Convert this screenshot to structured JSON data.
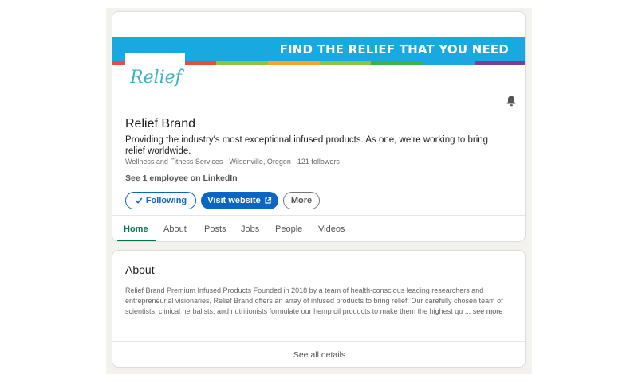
{
  "banner": {
    "text": "FIND THE RELIEF THAT YOU NEED",
    "bg_color": "#1aa8e0",
    "stripe_colors": [
      "#e94b3c",
      "#8cc63f",
      "#f4a62a",
      "#8cc63f",
      "#3bb34a",
      "#1aa8e0",
      "#7b3f99"
    ]
  },
  "logo": {
    "text": "Relief",
    "tm": "™",
    "color": "#3bb3c3"
  },
  "company": {
    "name": "Relief Brand",
    "tagline": "Providing the industry's most exceptional infused products. As one, we're working to bring relief worldwide.",
    "meta": "Wellness and Fitness Services · Wilsonville, Oregon · 121 followers",
    "employees_link": "See 1 employee on LinkedIn",
    "notification_icon": "bell-icon"
  },
  "actions": {
    "following_label": "Following",
    "following_icon": "check-icon",
    "visit_label": "Visit website",
    "visit_icon": "external-link-icon",
    "more_label": "More"
  },
  "tabs": [
    {
      "label": "Home",
      "active": true
    },
    {
      "label": "About",
      "active": false
    },
    {
      "label": "Posts",
      "active": false
    },
    {
      "label": "Jobs",
      "active": false
    },
    {
      "label": "People",
      "active": false
    },
    {
      "label": "Videos",
      "active": false
    }
  ],
  "about": {
    "title": "About",
    "description": "Relief Brand Premium Infused Products Founded in 2018 by a team of health-conscious leading researchers and entrepreneurial visionaries, Relief Brand offers an array of infused products to bring relief. Our carefully chosen team of scientists, clinical herbalists, and nutritionists formulate our hemp oil products to make them the highest qu ...",
    "see_more": "see more",
    "see_all": "See all details"
  },
  "colors": {
    "primary_blue": "#0a66c2",
    "active_tab_green": "#057642"
  }
}
